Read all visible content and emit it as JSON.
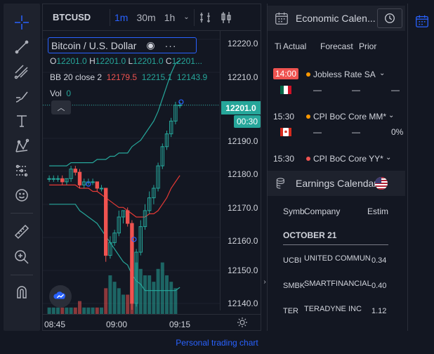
{
  "left_toolbar": {
    "tools": [
      "crosshair-icon",
      "trend-line-icon",
      "fib-icon",
      "brush-icon",
      "text-icon",
      "pattern-icon",
      "measure-icon",
      "emoji-icon",
      "ruler-icon",
      "zoom-in-icon",
      "magnet-icon"
    ]
  },
  "topbar": {
    "symbol": "BTCUSD",
    "intervals": [
      "1m",
      "30m",
      "1h"
    ],
    "active_interval": "1m"
  },
  "legend": {
    "title": "Bitcoin / U.S. Dollar",
    "ohlc": {
      "o_label": "O",
      "o": "12201.0",
      "h_label": "H",
      "h": "12201.0",
      "l_label": "L",
      "l": "12201.0",
      "c_label": "C",
      "c": "12201..."
    },
    "bb": {
      "label": "BB 20 close 2",
      "basis": "12179.5",
      "upper": "12215.1",
      "lower": "12143.9"
    },
    "vol": {
      "label": "Vol",
      "value": "0"
    }
  },
  "price_axis": {
    "ticks": [
      "12220.0",
      "12210.0",
      "12201.0",
      "12190.0",
      "12180.0",
      "12170.0",
      "12160.0",
      "12150.0",
      "12140.0"
    ],
    "last_price": "12201.0",
    "countdown": "00:30"
  },
  "time_axis": {
    "labels": [
      "08:45",
      "09:00",
      "09:15"
    ]
  },
  "chart_data": {
    "type": "candlestick",
    "ylim": [
      12137,
      12222
    ],
    "last_price": 12201.0,
    "candles": [
      {
        "o": 12178,
        "h": 12179,
        "l": 12177,
        "c": 12178
      },
      {
        "o": 12178,
        "h": 12179,
        "l": 12177,
        "c": 12178
      },
      {
        "o": 12178,
        "h": 12179,
        "l": 12177,
        "c": 12178
      },
      {
        "o": 12178,
        "h": 12179,
        "l": 12176,
        "c": 12177
      },
      {
        "o": 12177,
        "h": 12178,
        "l": 12176,
        "c": 12178
      },
      {
        "o": 12178,
        "h": 12182,
        "l": 12177,
        "c": 12181
      },
      {
        "o": 12181,
        "h": 12182,
        "l": 12179,
        "c": 12180
      },
      {
        "o": 12180,
        "h": 12181,
        "l": 12175,
        "c": 12176
      },
      {
        "o": 12176,
        "h": 12178,
        "l": 12175,
        "c": 12177
      },
      {
        "o": 12177,
        "h": 12178,
        "l": 12176,
        "c": 12177
      },
      {
        "o": 12177,
        "h": 12178,
        "l": 12176,
        "c": 12177
      },
      {
        "o": 12177,
        "h": 12177,
        "l": 12174,
        "c": 12175
      },
      {
        "o": 12175,
        "h": 12176,
        "l": 12174,
        "c": 12175
      },
      {
        "o": 12175,
        "h": 12175,
        "l": 12152,
        "c": 12154
      },
      {
        "o": 12154,
        "h": 12160,
        "l": 12153,
        "c": 12158
      },
      {
        "o": 12158,
        "h": 12162,
        "l": 12157,
        "c": 12161
      },
      {
        "o": 12161,
        "h": 12168,
        "l": 12160,
        "c": 12166
      },
      {
        "o": 12166,
        "h": 12168,
        "l": 12164,
        "c": 12168
      },
      {
        "o": 12168,
        "h": 12169,
        "l": 12163,
        "c": 12164
      },
      {
        "o": 12164,
        "h": 12165,
        "l": 12137,
        "c": 12139
      },
      {
        "o": 12139,
        "h": 12156,
        "l": 12138,
        "c": 12155
      },
      {
        "o": 12155,
        "h": 12165,
        "l": 12154,
        "c": 12163
      },
      {
        "o": 12163,
        "h": 12170,
        "l": 12162,
        "c": 12168
      },
      {
        "o": 12168,
        "h": 12174,
        "l": 12167,
        "c": 12172
      },
      {
        "o": 12172,
        "h": 12176,
        "l": 12170,
        "c": 12175
      },
      {
        "o": 12175,
        "h": 12183,
        "l": 12174,
        "c": 12182
      },
      {
        "o": 12182,
        "h": 12189,
        "l": 12181,
        "c": 12188
      },
      {
        "o": 12188,
        "h": 12193,
        "l": 12187,
        "c": 12192
      },
      {
        "o": 12192,
        "h": 12197,
        "l": 12191,
        "c": 12196
      },
      {
        "o": 12196,
        "h": 12202,
        "l": 12195,
        "c": 12201
      },
      {
        "o": 12201,
        "h": 12202,
        "l": 12200,
        "c": 12201
      }
    ],
    "volume": [
      1,
      1,
      1,
      1,
      1,
      1,
      1,
      2,
      1,
      1,
      1,
      1,
      1,
      4,
      6,
      5,
      4,
      3,
      3,
      12,
      8,
      7,
      6,
      6,
      5,
      7,
      8,
      6,
      5,
      4,
      0
    ],
    "bb_upper": [
      12182,
      12182,
      12182,
      12182,
      12182,
      12183,
      12183,
      12183,
      12183,
      12183,
      12183,
      12184,
      12184,
      12184,
      12185,
      12185,
      12186,
      12186,
      12186,
      12188,
      12189,
      12190,
      12192,
      12194,
      12196,
      12199,
      12203,
      12207,
      12211,
      12214,
      12215
    ],
    "bb_basis": [
      12176,
      12176,
      12176,
      12176,
      12176,
      12176,
      12176,
      12175,
      12175,
      12175,
      12174,
      12174,
      12173,
      12172,
      12171,
      12170,
      12169,
      12169,
      12168,
      12167,
      12166,
      12166,
      12166,
      12167,
      12167,
      12168,
      12170,
      12172,
      12175,
      12177,
      12179
    ],
    "bb_lower": [
      12170,
      12170,
      12170,
      12170,
      12170,
      12170,
      12170,
      12168,
      12167,
      12166,
      12165,
      12164,
      12162,
      12160,
      12158,
      12156,
      12154,
      12152,
      12151,
      12148,
      12146,
      12145,
      12143,
      12143,
      12143,
      12143,
      12143,
      12143,
      12143,
      12143,
      12144
    ]
  },
  "economic_calendar": {
    "title": "Economic Calen...",
    "columns": {
      "time": "Ti",
      "actual": "Actual",
      "forecast": "Forecast",
      "prior": "Prior"
    },
    "events": [
      {
        "time": "14:00",
        "name": "Jobless Rate SA",
        "actual": "—",
        "forecast": "—",
        "prior": "—"
      },
      {
        "time": "15:30",
        "name": "CPI BoC Core MM*",
        "actual": "—",
        "forecast": "—",
        "prior": "0%"
      },
      {
        "time": "15:30",
        "name": "CPI BoC Core YY*",
        "actual": "",
        "forecast": "",
        "prior": ""
      }
    ]
  },
  "earnings_calendar": {
    "title": "Earnings Calendar",
    "columns": {
      "symbol": "Symb",
      "company": "Company",
      "estimate": "Estim"
    },
    "month": "OCTOBER 21",
    "rows": [
      {
        "symbol": "UCBI",
        "company": "UNITED COMMUN",
        "estimate": "0.34"
      },
      {
        "symbol": "SMBK",
        "company": "SMARTFINANCIAL",
        "estimate": "0.40"
      },
      {
        "symbol": "TER",
        "company": "TERADYNE INC",
        "estimate": "1.12"
      }
    ]
  },
  "caption": "Personal trading chart",
  "colors": {
    "up": "#26a69a",
    "down": "#ef5350",
    "accent": "#2962ff",
    "bb_band": "#26a69a",
    "bb_basis": "#e53935"
  }
}
